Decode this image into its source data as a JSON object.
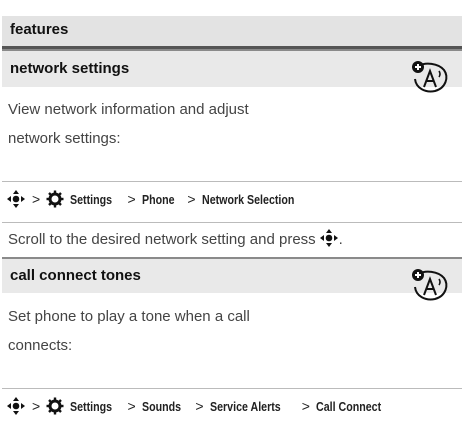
{
  "header": {
    "title": "features"
  },
  "sections": [
    {
      "title": "network settings",
      "desc_lines": [
        "View network information and adjust",
        "network settings:"
      ],
      "path": {
        "settings": "Settings",
        "steps": [
          "Phone",
          "Network Selection"
        ]
      },
      "note": "Scroll to the desired network setting and press"
    },
    {
      "title": "call connect tones",
      "desc_lines": [
        "Set phone to play a tone when a call",
        "connects:"
      ],
      "path": {
        "settings": "Settings",
        "steps": [
          "Sounds",
          "Service Alerts",
          "Call Connect"
        ]
      }
    }
  ],
  "path_separator": ">",
  "icons": {
    "nav_key": "nav-key-icon",
    "settings": "settings-gear-icon",
    "badge": "network-feature-badge-icon"
  }
}
